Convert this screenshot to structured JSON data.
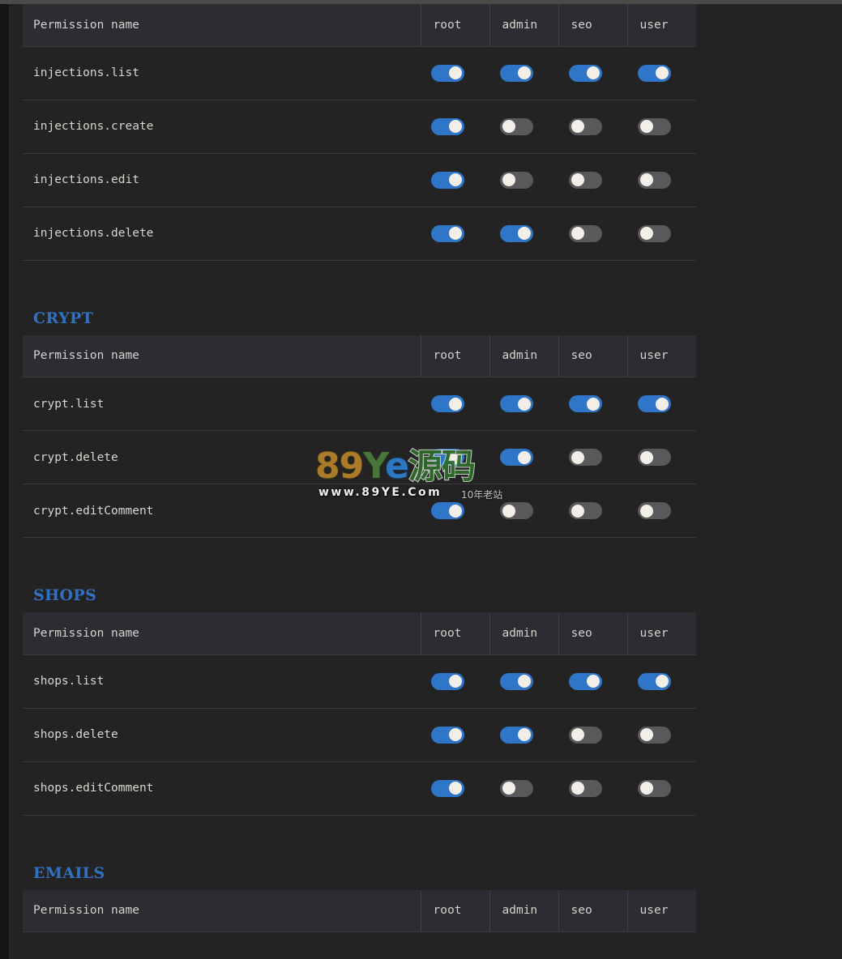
{
  "columns": [
    "root",
    "admin",
    "seo",
    "user"
  ],
  "name_column_header": "Permission name",
  "accent_color": "#2f72c4",
  "toggle_on_color": "#2f75c8",
  "toggle_off_color": "#59585a",
  "sections": [
    {
      "title": "",
      "title_visible": false,
      "header": "Permission name",
      "rows": [
        {
          "name": "injections.list",
          "values": [
            true,
            true,
            true,
            true
          ]
        },
        {
          "name": "injections.create",
          "values": [
            true,
            false,
            false,
            false
          ]
        },
        {
          "name": "injections.edit",
          "values": [
            true,
            false,
            false,
            false
          ]
        },
        {
          "name": "injections.delete",
          "values": [
            true,
            true,
            false,
            false
          ]
        }
      ]
    },
    {
      "title": "CRYPT",
      "title_visible": true,
      "header": "Permission name",
      "rows": [
        {
          "name": "crypt.list",
          "values": [
            true,
            true,
            true,
            true
          ]
        },
        {
          "name": "crypt.delete",
          "values": [
            true,
            true,
            false,
            false
          ]
        },
        {
          "name": "crypt.editComment",
          "values": [
            true,
            false,
            false,
            false
          ]
        }
      ]
    },
    {
      "title": "SHOPS",
      "title_visible": true,
      "header": "Permission name",
      "rows": [
        {
          "name": "shops.list",
          "values": [
            true,
            true,
            true,
            true
          ]
        },
        {
          "name": "shops.delete",
          "values": [
            true,
            true,
            false,
            false
          ]
        },
        {
          "name": "shops.editComment",
          "values": [
            true,
            false,
            false,
            false
          ]
        }
      ]
    },
    {
      "title": "EMAILS",
      "title_visible": true,
      "header": "Permission name",
      "rows": []
    }
  ],
  "watermark": {
    "part_89": "89",
    "part_y": "Y",
    "part_e": "e",
    "part_cn": "源码",
    "url": "www.89YE.Com",
    "tagline": "10年老站"
  }
}
